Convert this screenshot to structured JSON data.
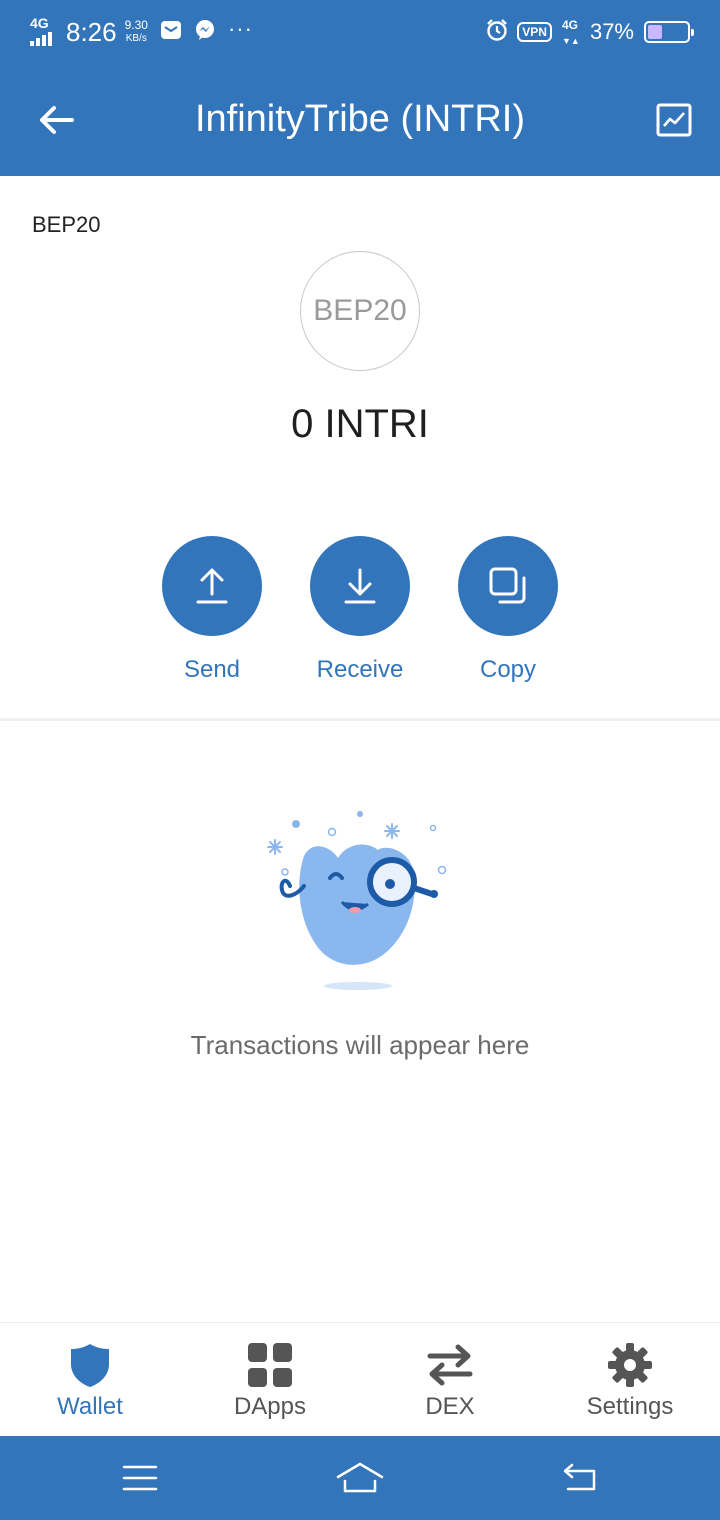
{
  "status_bar": {
    "network": "4G",
    "time": "8:26",
    "speed_value": "9.30",
    "speed_unit": "KB/s",
    "more": "···",
    "vpn": "VPN",
    "network_right": "4G",
    "battery_percent": "37%",
    "battery_level": 0.37
  },
  "header": {
    "title": "InfinityTribe (INTRI)"
  },
  "token": {
    "network_label": "BEP20",
    "logo_text": "BEP20",
    "balance": "0 INTRI"
  },
  "actions": {
    "send": "Send",
    "receive": "Receive",
    "copy": "Copy"
  },
  "empty_state": {
    "message": "Transactions will appear here"
  },
  "bottom_nav": {
    "items": [
      {
        "label": "Wallet",
        "icon": "shield-icon",
        "active": true
      },
      {
        "label": "DApps",
        "icon": "grid-icon",
        "active": false
      },
      {
        "label": "DEX",
        "icon": "swap-arrows-icon",
        "active": false
      },
      {
        "label": "Settings",
        "icon": "gear-icon",
        "active": false
      }
    ]
  },
  "colors": {
    "brand": "#3375bb",
    "inactive_nav": "#555555",
    "mascot_fill": "#8ab8ee"
  }
}
